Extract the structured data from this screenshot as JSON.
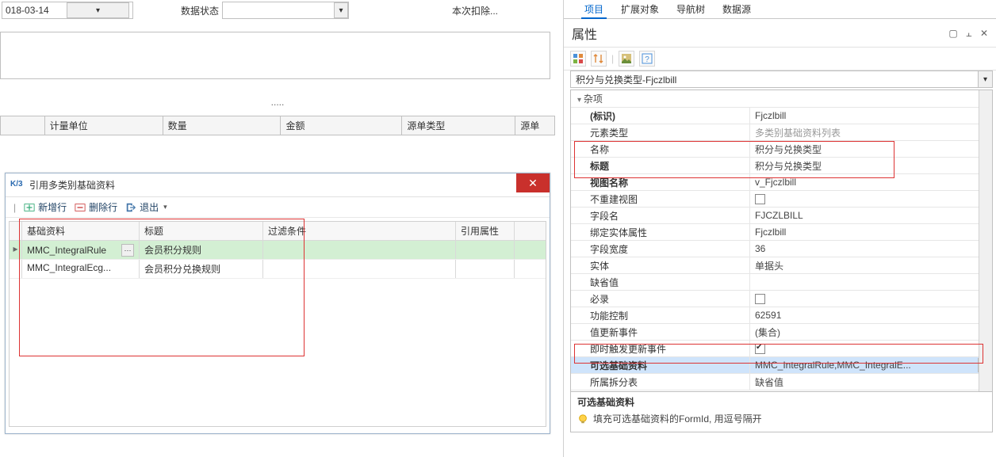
{
  "top": {
    "date": "018-03-14",
    "status_label": "数据状态",
    "deduct_label": "本次扣除..."
  },
  "dots": ".....",
  "grid_headers": [
    "计量单位",
    "数量",
    "金额",
    "源单类型",
    "源单"
  ],
  "dialog": {
    "title": "引用多类别基础资料",
    "toolbar": {
      "addrow": "新增行",
      "delrow": "删除行",
      "exit": "退出"
    },
    "cols": [
      "基础资料",
      "标题",
      "过滤条件",
      "引用属性"
    ],
    "rows": [
      {
        "base": "MMC_IntegralRule",
        "title": "会员积分规则"
      },
      {
        "base": "MMC_IntegralEcg...",
        "title": "会员积分兑换规则"
      }
    ]
  },
  "tabs": [
    "项目",
    "扩展对象",
    "导航树",
    "数据源"
  ],
  "panel_title": "属性",
  "combo_value": "积分与兑换类型-Fjczlbill",
  "section": "杂项",
  "props": [
    {
      "k": "(标识)",
      "v": "Fjczlbill",
      "bold": true
    },
    {
      "k": "元素类型",
      "v": "多类别基础资料列表",
      "gray": true
    },
    {
      "k": "名称",
      "v": "积分与兑换类型"
    },
    {
      "k": "标题",
      "v": "积分与兑换类型",
      "bold": true
    },
    {
      "k": "视图名称",
      "v": "v_Fjczlbill",
      "bold": true
    },
    {
      "k": "不重建视图",
      "chk": false
    },
    {
      "k": "字段名",
      "v": "FJCZLBILL"
    },
    {
      "k": "绑定实体属性",
      "v": "Fjczlbill"
    },
    {
      "k": "字段宽度",
      "v": "36"
    },
    {
      "k": "实体",
      "v": "单据头"
    },
    {
      "k": "缺省值",
      "v": ""
    },
    {
      "k": "必录",
      "chk": false
    },
    {
      "k": "功能控制",
      "v": "62591"
    },
    {
      "k": "值更新事件",
      "v": "(集合)"
    },
    {
      "k": "即时触发更新事件",
      "chk": true
    },
    {
      "k": "可选基础资料",
      "v": "MMC_IntegralRule,MMC_IntegralE...",
      "bold": true,
      "sel": true,
      "btn": true
    },
    {
      "k": "所属拆分表",
      "v": "缺省值"
    }
  ],
  "desc": {
    "title": "可选基础资料",
    "body": "填充可选基础资料的FormId, 用逗号隔开"
  }
}
